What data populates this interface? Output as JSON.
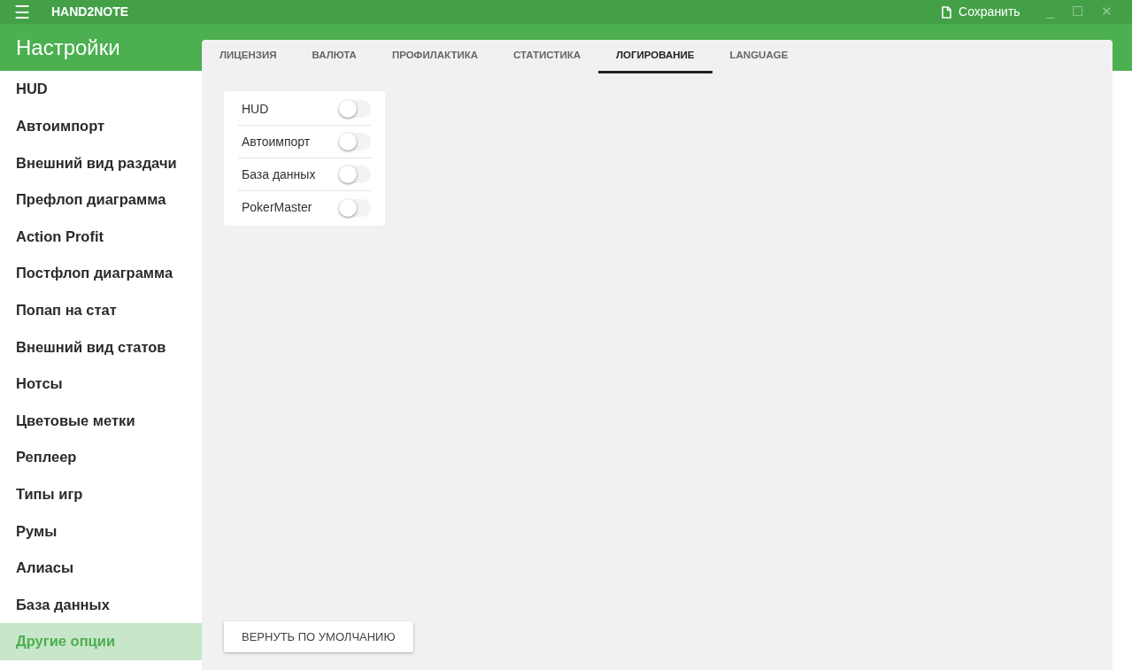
{
  "window": {
    "menu_glyph": "☰",
    "title": "HAND2NOTE",
    "save": "Сохранить",
    "minimize": "_",
    "maximize": "☐",
    "close": "✕"
  },
  "sidebar": {
    "title": "Настройки",
    "items": [
      {
        "label": "HUD",
        "selected": false
      },
      {
        "label": "Автоимпорт",
        "selected": false
      },
      {
        "label": "Внешний вид раздачи",
        "selected": false
      },
      {
        "label": "Префлоп диаграмма",
        "selected": false
      },
      {
        "label": "Action Profit",
        "selected": false
      },
      {
        "label": "Постфлоп диаграмма",
        "selected": false
      },
      {
        "label": "Попап на стат",
        "selected": false
      },
      {
        "label": "Внешний вид статов",
        "selected": false
      },
      {
        "label": "Нотсы",
        "selected": false
      },
      {
        "label": "Цветовые метки",
        "selected": false
      },
      {
        "label": "Реплеер",
        "selected": false
      },
      {
        "label": "Типы игр",
        "selected": false
      },
      {
        "label": "Румы",
        "selected": false
      },
      {
        "label": "Алиасы",
        "selected": false
      },
      {
        "label": "База данных",
        "selected": false
      },
      {
        "label": "Другие опции",
        "selected": true
      }
    ]
  },
  "tabs": [
    {
      "label": "ЛИЦЕНЗИЯ",
      "selected": false
    },
    {
      "label": "ВАЛЮТА",
      "selected": false
    },
    {
      "label": "ПРОФИЛАКТИКА",
      "selected": false
    },
    {
      "label": "СТАТИСТИКА",
      "selected": false
    },
    {
      "label": "ЛОГИРОВАНИЕ",
      "selected": true
    },
    {
      "label": "LANGUAGE",
      "selected": false
    }
  ],
  "logging": [
    {
      "label": "HUD",
      "on": false
    },
    {
      "label": "Автоимпорт",
      "on": false
    },
    {
      "label": "База данных",
      "on": false
    },
    {
      "label": "PokerMaster",
      "on": false
    }
  ],
  "reset_button": "ВЕРНУТЬ ПО УМОЛЧАНИЮ"
}
